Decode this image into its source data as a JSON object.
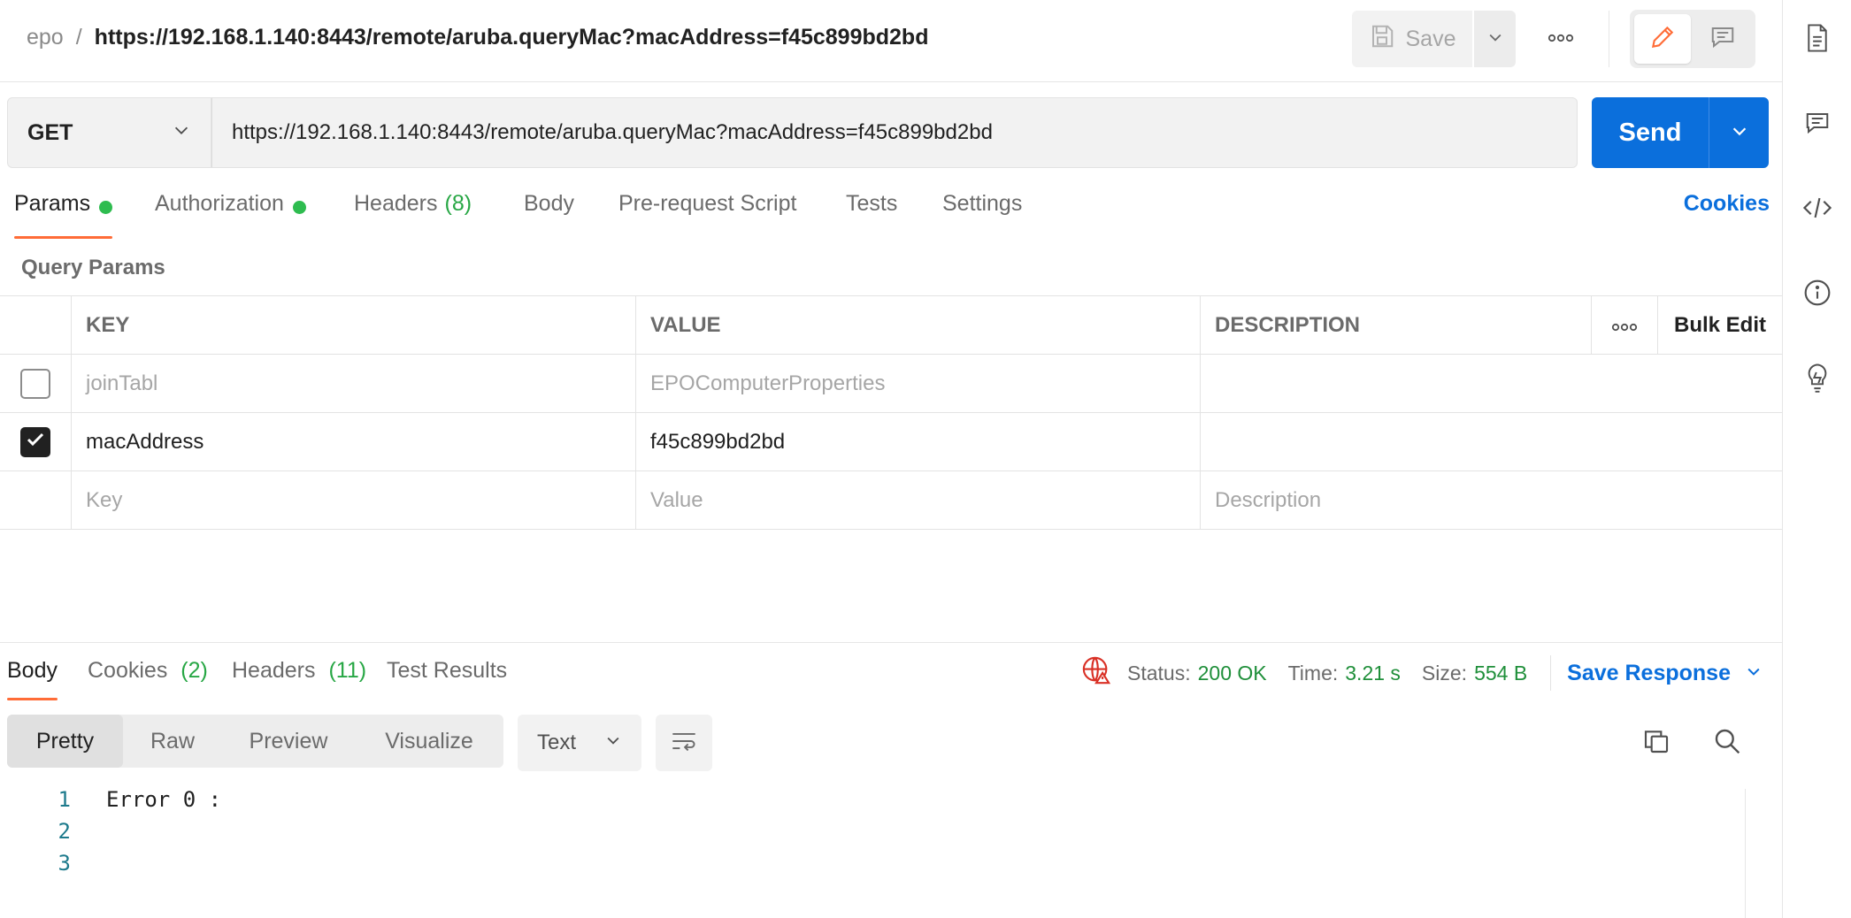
{
  "breadcrumb": {
    "parent": "epo",
    "separator": "/",
    "title": "https://192.168.1.140:8443/remote/aruba.queryMac?macAddress=f45c899bd2bd"
  },
  "toolbar": {
    "save_label": "Save",
    "icons": [
      "save-icon",
      "chevron-down-icon",
      "more-icon",
      "edit-icon",
      "comment-icon"
    ]
  },
  "right_rail": {
    "icons": [
      "documentation-icon",
      "comments-icon",
      "code-icon",
      "info-icon",
      "lightbulb-icon"
    ]
  },
  "request": {
    "method": "GET",
    "url": "https://192.168.1.140:8443/remote/aruba.queryMac?macAddress=f45c899bd2bd",
    "send_label": "Send"
  },
  "request_tabs": [
    {
      "label": "Params",
      "dot": true,
      "count": "",
      "active": true
    },
    {
      "label": "Authorization",
      "dot": true,
      "count": "",
      "active": false
    },
    {
      "label": "Headers",
      "dot": false,
      "count": "(8)",
      "active": false
    },
    {
      "label": "Body",
      "dot": false,
      "count": "",
      "active": false
    },
    {
      "label": "Pre-request Script",
      "dot": false,
      "count": "",
      "active": false
    },
    {
      "label": "Tests",
      "dot": false,
      "count": "",
      "active": false
    },
    {
      "label": "Settings",
      "dot": false,
      "count": "",
      "active": false
    }
  ],
  "cookies_link": "Cookies",
  "query_params": {
    "label": "Query Params",
    "columns": {
      "key": "KEY",
      "value": "VALUE",
      "description": "DESCRIPTION",
      "bulk_edit": "Bulk Edit"
    },
    "rows": [
      {
        "checked": false,
        "key": "joinTabl",
        "value": "EPOComputerProperties",
        "description": ""
      },
      {
        "checked": true,
        "key": "macAddress",
        "value": "f45c899bd2bd",
        "description": ""
      }
    ],
    "placeholders": {
      "key": "Key",
      "value": "Value",
      "description": "Description"
    }
  },
  "response_tabs": [
    {
      "label": "Body",
      "count": "",
      "active": true
    },
    {
      "label": "Cookies",
      "count": "(2)",
      "active": false
    },
    {
      "label": "Headers",
      "count": "(11)",
      "active": false
    },
    {
      "label": "Test Results",
      "count": "",
      "active": false
    }
  ],
  "response_meta": {
    "status_label": "Status:",
    "status_value": "200 OK",
    "time_label": "Time:",
    "time_value": "3.21 s",
    "size_label": "Size:",
    "size_value": "554 B",
    "save_response": "Save Response"
  },
  "view_modes": [
    "Pretty",
    "Raw",
    "Preview",
    "Visualize"
  ],
  "active_view_mode": "Pretty",
  "format": "Text",
  "body_lines": [
    {
      "n": "1",
      "text": "Error 0 :"
    },
    {
      "n": "2",
      "text": ""
    },
    {
      "n": "3",
      "text": ""
    }
  ],
  "colors": {
    "accent": "#0b6fdc",
    "tab_underline": "#ff6c37",
    "success": "#1f8f3a",
    "dot": "#2ebc4f"
  }
}
